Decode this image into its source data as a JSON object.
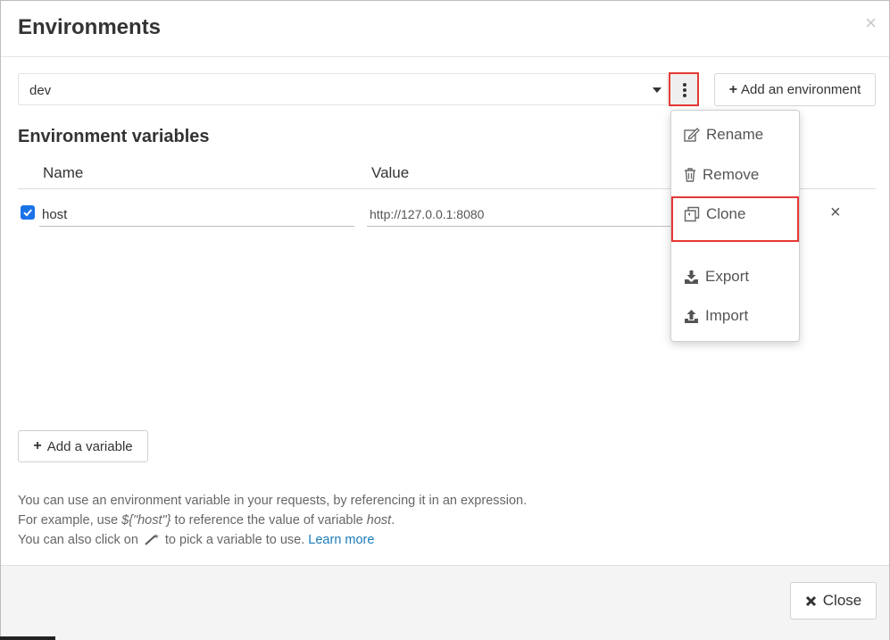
{
  "dialog": {
    "title": "Environments",
    "close_icon": "×"
  },
  "env_select": {
    "value": "dev"
  },
  "toolbar": {
    "add_environment_label": "Add an environment"
  },
  "variables": {
    "title": "Environment variables",
    "columns": {
      "name": "Name",
      "value": "Value"
    },
    "rows": [
      {
        "enabled": true,
        "name": "host",
        "value": "http://127.0.0.1:8080"
      }
    ],
    "remove_icon": "×",
    "add_label": "Add a variable"
  },
  "menu": {
    "items": [
      {
        "label": "Rename",
        "icon": "edit-icon"
      },
      {
        "label": "Remove",
        "icon": "trash-icon"
      },
      {
        "label": "Clone",
        "icon": "clone-icon"
      },
      {
        "label": "Export",
        "icon": "download-icon"
      },
      {
        "label": "Import",
        "icon": "upload-icon"
      }
    ]
  },
  "help": {
    "line1": "You can use an environment variable in your requests, by referencing it in an expression.",
    "line2_a": "For example, use ",
    "line2_expr": "${\"host\"}",
    "line2_b": " to reference the value of variable ",
    "line2_var": "host",
    "line2_c": ".",
    "line3_a": "You can also click on",
    "line3_b": "to pick a variable to use.",
    "learn_more": "Learn more"
  },
  "footer": {
    "close_label": "Close"
  },
  "colors": {
    "highlight": "#e53935",
    "checkbox": "#1a73e8",
    "link": "#1a7bb9"
  }
}
